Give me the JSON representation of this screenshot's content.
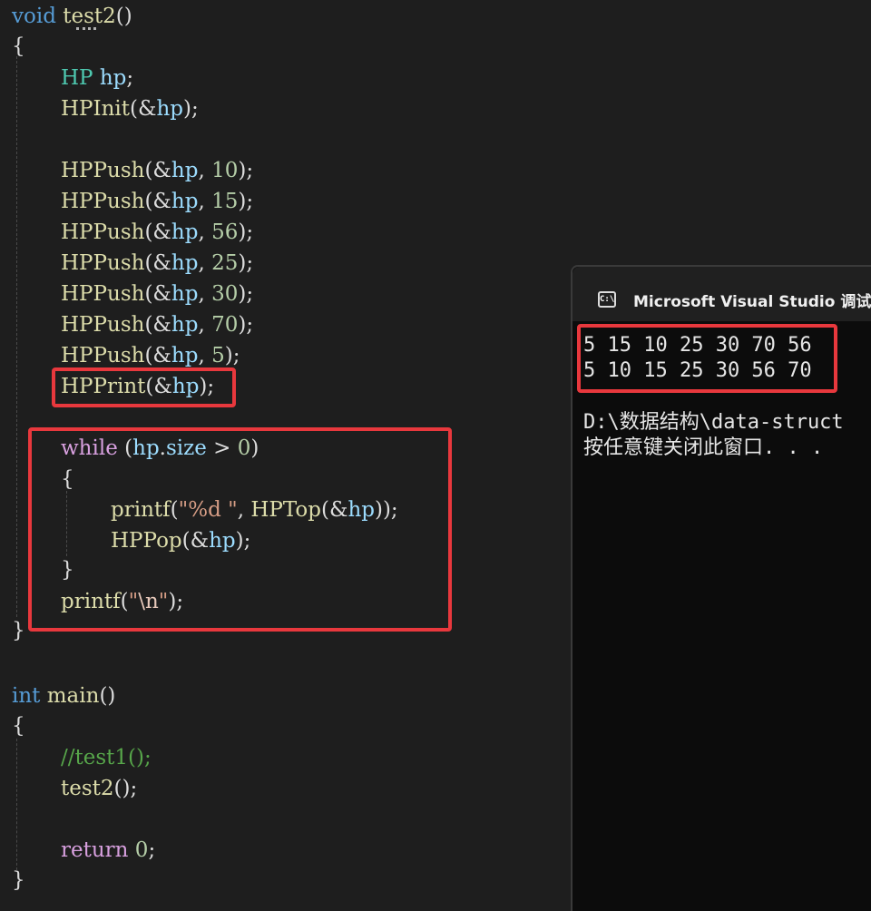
{
  "editor": {
    "lines": {
      "l1": {
        "kw": "void",
        "fn": "test2",
        "p": "()"
      },
      "l2": "{",
      "l3": {
        "type": "HP",
        "var": "hp",
        "p": ";"
      },
      "l4": {
        "fn": "HPInit",
        "p1": "(&",
        "var": "hp",
        "p2": ");"
      },
      "push_fn": "HPPush",
      "push_values": [
        "10",
        "15",
        "56",
        "25",
        "30",
        "70",
        "5"
      ],
      "l12": {
        "fn": "HPPrint",
        "p1": "(&",
        "var": "hp",
        "p2": ");"
      },
      "l13": {
        "kw": "while",
        "p1": " (",
        "var": "hp",
        "p2": ".",
        "member": "size",
        "p3": " > ",
        "num": "0",
        "p4": ")"
      },
      "l14": "{",
      "l15": {
        "fn": "printf",
        "p1": "(",
        "str": "\"%d \"",
        "p2": ", ",
        "fn2": "HPTop",
        "p3": "(&",
        "var": "hp",
        "p4": "));"
      },
      "l16": {
        "fn": "HPPop",
        "p1": "(&",
        "var": "hp",
        "p2": ");"
      },
      "l17": "}",
      "l18": {
        "fn": "printf",
        "p1": "(",
        "q1": "\"",
        "esc": "\\n",
        "q2": "\"",
        "p2": ");"
      },
      "l19": "}",
      "l21": {
        "kw": "int",
        "fn": "main",
        "p": "()"
      },
      "l22": "{",
      "l23": "//test1();",
      "l24": {
        "fn": "test2",
        "p": "();"
      },
      "l26": {
        "kw": "return",
        "num": "0",
        "p": ";"
      },
      "l27": "}"
    },
    "colors": {
      "background": "#1e1e1e",
      "keyword": "#569cd6",
      "control": "#d8a0df",
      "type": "#4ec9b0",
      "function": "#dcdcaa",
      "variable": "#9cdcfe",
      "number": "#b5cea8",
      "string": "#d69d85",
      "comment": "#57a64a",
      "highlight": "#e8383d"
    }
  },
  "console": {
    "icon_label": "C:\\",
    "title": "Microsoft Visual Studio 调试控",
    "output": [
      "5 15 10 25 30 70 56",
      "5 10 15 25 30 56 70"
    ],
    "path_line": "D:\\数据结构\\data-struct",
    "prompt_line": "按任意键关闭此窗口. . ."
  }
}
